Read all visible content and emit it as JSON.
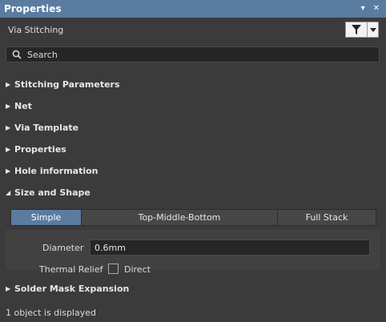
{
  "window": {
    "title": "Properties",
    "dropdown_glyph": "▾",
    "close_glyph": "✕"
  },
  "header": {
    "subtitle": "Via Stitching",
    "filter_icon": "filter-icon"
  },
  "search": {
    "placeholder": "Search"
  },
  "sections": [
    {
      "label": "Stitching Parameters",
      "expanded": false
    },
    {
      "label": "Net",
      "expanded": false
    },
    {
      "label": "Via Template",
      "expanded": false
    },
    {
      "label": "Properties",
      "expanded": false
    },
    {
      "label": "Hole information",
      "expanded": false
    },
    {
      "label": "Size and Shape",
      "expanded": true
    },
    {
      "label": "Solder Mask Expansion",
      "expanded": false
    }
  ],
  "size_and_shape": {
    "modes": [
      "Simple",
      "Top-Middle-Bottom",
      "Full Stack"
    ],
    "selected_mode": "Simple",
    "diameter_label": "Diameter",
    "diameter_value": "0.6mm",
    "thermal_relief_label": "Thermal Relief",
    "direct_label": "Direct",
    "direct_checked": false
  },
  "status": {
    "text": "1 object is displayed"
  },
  "colors": {
    "accent": "#5a7ca1",
    "panel_bg": "#3b3b3b",
    "field_bg": "#262626"
  }
}
